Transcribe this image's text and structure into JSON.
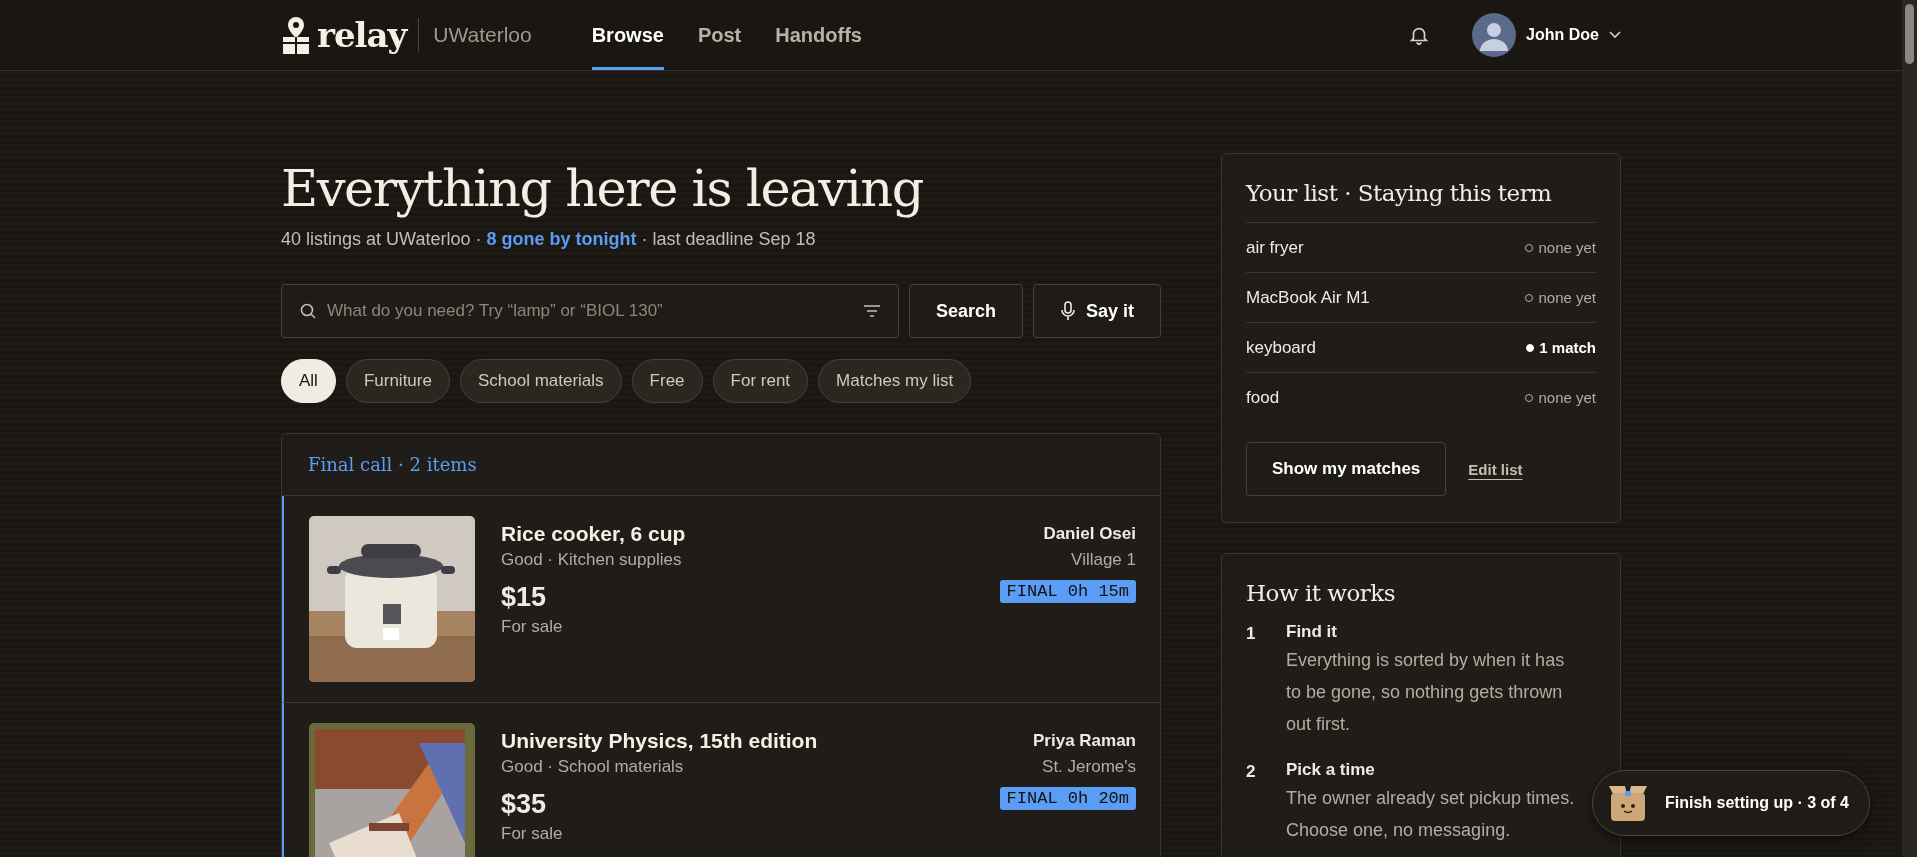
{
  "nav": {
    "brand": "relay",
    "campus": "UWaterloo",
    "tabs": [
      {
        "label": "Browse",
        "selected": true
      },
      {
        "label": "Post",
        "selected": false
      },
      {
        "label": "Handoffs",
        "selected": false
      }
    ],
    "user": {
      "name": "John Doe"
    }
  },
  "hero": {
    "title": "Everything here is leaving",
    "subtitle": {
      "before": "40 listings at UWaterloo · ",
      "link": "8 gone by tonight",
      "after": " · last deadline Sep 18"
    }
  },
  "search": {
    "placeholder": "What do you need? Try “lamp” or “BIOL 130”",
    "search_button": "Search",
    "voice_button": "Say it"
  },
  "chips": [
    {
      "label": "All",
      "selected": true
    },
    {
      "label": "Furniture",
      "selected": false
    },
    {
      "label": "School materials",
      "selected": false
    },
    {
      "label": "Free",
      "selected": false
    },
    {
      "label": "For rent",
      "selected": false
    },
    {
      "label": "Matches my list",
      "selected": false
    }
  ],
  "section": {
    "title": "Final call · 2 items",
    "listings": [
      {
        "title": "Rice cooker, 6 cup",
        "meta": "Good · Kitchen supplies",
        "price": "$15",
        "listing_type": "For sale",
        "seller": "Daniel Osei",
        "location": "Village 1",
        "badge": "FINAL 0h 15m"
      },
      {
        "title": "University Physics, 15th edition",
        "meta": "Good · School materials",
        "price": "$35",
        "listing_type": "For sale",
        "seller": "Priya Raman",
        "location": "St. Jerome's",
        "badge": "FINAL 0h 20m"
      }
    ]
  },
  "list_card": {
    "title": "Your list · Staying this term",
    "items": [
      {
        "name": "air fryer",
        "status": "none yet",
        "matched": false
      },
      {
        "name": "MacBook Air M1",
        "status": "none yet",
        "matched": false
      },
      {
        "name": "keyboard",
        "status": "1 match",
        "matched": true
      },
      {
        "name": "food",
        "status": "none yet",
        "matched": false
      }
    ],
    "button": "Show my matches",
    "link": "Edit list"
  },
  "how_card": {
    "title": "How it works",
    "steps": [
      {
        "number": "1",
        "title": "Find it",
        "body": "Everything is sorted by when it has to be gone, so nothing gets thrown out first."
      },
      {
        "number": "2",
        "title": "Pick a time",
        "body": "The owner already set pickup times. Choose one, no messaging."
      }
    ]
  },
  "toast": {
    "label": "Finish setting up · 3 of 4"
  }
}
